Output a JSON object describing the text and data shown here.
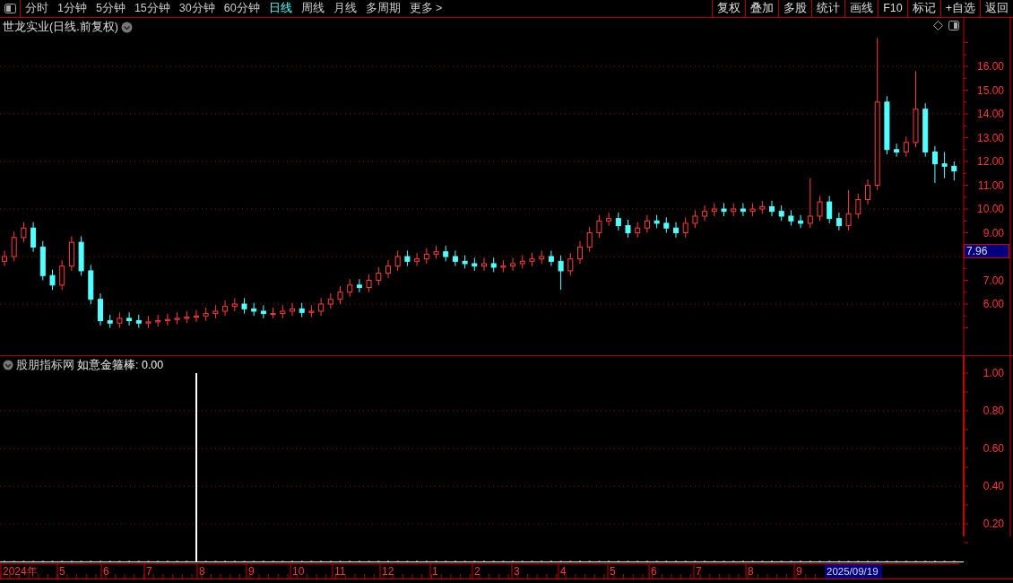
{
  "toolbar": {
    "periods": [
      {
        "label": "分时",
        "selected": false
      },
      {
        "label": "1分钟",
        "selected": false
      },
      {
        "label": "5分钟",
        "selected": false
      },
      {
        "label": "15分钟",
        "selected": false
      },
      {
        "label": "30分钟",
        "selected": false
      },
      {
        "label": "60分钟",
        "selected": false
      },
      {
        "label": "日线",
        "selected": true
      },
      {
        "label": "周线",
        "selected": false
      },
      {
        "label": "月线",
        "selected": false
      },
      {
        "label": "多周期",
        "selected": false
      },
      {
        "label": "更多 >",
        "selected": false
      }
    ],
    "buttons": [
      "复权",
      "叠加",
      "多股",
      "统计",
      "画线",
      "F10",
      "标记",
      "+自选",
      "返回"
    ]
  },
  "main_chart": {
    "title": "世龙实业(日线.前复权)",
    "cursor_price": "7.96",
    "chart_data": {
      "type": "candlestick",
      "ylim": [
        3.85,
        18.04
      ],
      "grid": true,
      "yticks": [
        {
          "value": 16,
          "label": "16.00"
        },
        {
          "value": 15,
          "label": "15.00"
        },
        {
          "value": 14,
          "label": "14.00"
        },
        {
          "value": 13,
          "label": "13.00"
        },
        {
          "value": 12,
          "label": "12.00"
        },
        {
          "value": 11,
          "label": "11.00"
        },
        {
          "value": 10,
          "label": "10.00"
        },
        {
          "value": 9,
          "label": "9.00"
        },
        {
          "value": 7,
          "label": "7.00"
        },
        {
          "value": 6,
          "label": "6.00"
        }
      ],
      "ohlc": [
        [
          7.8,
          8.25,
          7.6,
          8.0
        ],
        [
          8.0,
          9.05,
          7.8,
          8.8
        ],
        [
          8.8,
          9.45,
          8.6,
          9.2
        ],
        [
          9.2,
          9.45,
          8.2,
          8.4
        ],
        [
          8.4,
          8.65,
          7.0,
          7.2
        ],
        [
          7.2,
          7.45,
          6.6,
          6.8
        ],
        [
          6.8,
          7.85,
          6.6,
          7.6
        ],
        [
          7.6,
          8.85,
          7.4,
          8.6
        ],
        [
          8.6,
          8.85,
          7.2,
          7.4
        ],
        [
          7.4,
          7.65,
          6.0,
          6.2
        ],
        [
          6.2,
          6.45,
          5.1,
          5.3
        ],
        [
          5.3,
          5.55,
          5.0,
          5.2
        ],
        [
          5.2,
          5.65,
          5.0,
          5.4
        ],
        [
          5.4,
          5.65,
          5.1,
          5.3
        ],
        [
          5.3,
          5.55,
          5.0,
          5.2
        ],
        [
          5.2,
          5.5,
          5.0,
          5.25
        ],
        [
          5.25,
          5.55,
          5.05,
          5.3
        ],
        [
          5.3,
          5.6,
          5.1,
          5.35
        ],
        [
          5.35,
          5.65,
          5.15,
          5.4
        ],
        [
          5.4,
          5.7,
          5.2,
          5.45
        ],
        [
          5.45,
          5.75,
          5.25,
          5.5
        ],
        [
          5.5,
          5.85,
          5.3,
          5.6
        ],
        [
          5.6,
          5.95,
          5.4,
          5.7
        ],
        [
          5.7,
          6.15,
          5.5,
          5.9
        ],
        [
          5.9,
          6.25,
          5.7,
          6.0
        ],
        [
          6.0,
          6.25,
          5.6,
          5.8
        ],
        [
          5.8,
          6.05,
          5.5,
          5.7
        ],
        [
          5.7,
          5.95,
          5.4,
          5.6
        ],
        [
          5.6,
          5.85,
          5.4,
          5.6
        ],
        [
          5.6,
          5.95,
          5.4,
          5.7
        ],
        [
          5.7,
          6.05,
          5.5,
          5.8
        ],
        [
          5.8,
          6.05,
          5.45,
          5.65
        ],
        [
          5.65,
          5.95,
          5.45,
          5.7
        ],
        [
          5.7,
          6.25,
          5.5,
          6.0
        ],
        [
          6.0,
          6.45,
          5.8,
          6.2
        ],
        [
          6.2,
          6.75,
          6.0,
          6.5
        ],
        [
          6.5,
          7.05,
          6.3,
          6.8
        ],
        [
          6.8,
          7.05,
          6.5,
          6.7
        ],
        [
          6.7,
          7.25,
          6.5,
          7.0
        ],
        [
          7.0,
          7.55,
          6.8,
          7.3
        ],
        [
          7.3,
          7.85,
          7.1,
          7.6
        ],
        [
          7.6,
          8.25,
          7.4,
          8.0
        ],
        [
          8.0,
          8.25,
          7.6,
          7.8
        ],
        [
          7.8,
          8.15,
          7.6,
          7.9
        ],
        [
          7.9,
          8.35,
          7.7,
          8.1
        ],
        [
          8.1,
          8.45,
          7.9,
          8.2
        ],
        [
          8.2,
          8.45,
          7.8,
          8.0
        ],
        [
          8.0,
          8.25,
          7.6,
          7.8
        ],
        [
          7.8,
          8.05,
          7.5,
          7.7
        ],
        [
          7.7,
          7.95,
          7.4,
          7.6
        ],
        [
          7.6,
          7.95,
          7.4,
          7.7
        ],
        [
          7.7,
          7.95,
          7.35,
          7.55
        ],
        [
          7.55,
          7.85,
          7.35,
          7.6
        ],
        [
          7.6,
          7.95,
          7.4,
          7.7
        ],
        [
          7.7,
          8.05,
          7.5,
          7.8
        ],
        [
          7.8,
          8.15,
          7.6,
          7.9
        ],
        [
          7.9,
          8.25,
          7.7,
          8.0
        ],
        [
          8.0,
          8.25,
          7.6,
          7.8
        ],
        [
          7.8,
          8.05,
          6.6,
          7.4
        ],
        [
          7.4,
          8.15,
          7.2,
          7.9
        ],
        [
          7.9,
          8.65,
          7.7,
          8.4
        ],
        [
          8.4,
          9.25,
          8.2,
          9.0
        ],
        [
          9.0,
          9.75,
          8.8,
          9.5
        ],
        [
          9.5,
          9.85,
          9.3,
          9.6
        ],
        [
          9.6,
          9.85,
          9.1,
          9.3
        ],
        [
          9.3,
          9.55,
          8.8,
          9.0
        ],
        [
          9.0,
          9.45,
          8.8,
          9.2
        ],
        [
          9.2,
          9.75,
          9.0,
          9.5
        ],
        [
          9.5,
          9.75,
          9.2,
          9.4
        ],
        [
          9.4,
          9.65,
          9.0,
          9.2
        ],
        [
          9.2,
          9.45,
          8.8,
          9.0
        ],
        [
          9.0,
          9.65,
          8.8,
          9.4
        ],
        [
          9.4,
          9.95,
          9.2,
          9.7
        ],
        [
          9.7,
          10.15,
          9.5,
          9.9
        ],
        [
          9.9,
          10.25,
          9.7,
          10.0
        ],
        [
          10.0,
          10.25,
          9.7,
          9.9
        ],
        [
          9.9,
          10.25,
          9.7,
          10.0
        ],
        [
          10.0,
          10.25,
          9.7,
          9.9
        ],
        [
          9.9,
          10.25,
          9.7,
          10.0
        ],
        [
          10.0,
          10.35,
          9.8,
          10.1
        ],
        [
          10.1,
          10.35,
          9.7,
          9.9
        ],
        [
          9.9,
          10.15,
          9.5,
          9.7
        ],
        [
          9.7,
          9.95,
          9.3,
          9.5
        ],
        [
          9.5,
          9.75,
          9.2,
          9.4
        ],
        [
          9.4,
          11.3,
          9.2,
          9.7
        ],
        [
          9.7,
          10.55,
          9.5,
          10.3
        ],
        [
          10.3,
          10.55,
          9.4,
          9.6
        ],
        [
          9.6,
          9.85,
          9.1,
          9.3
        ],
        [
          9.3,
          10.8,
          9.1,
          9.8
        ],
        [
          9.8,
          10.65,
          9.6,
          10.4
        ],
        [
          10.4,
          11.25,
          10.2,
          11.0
        ],
        [
          11.0,
          17.2,
          10.8,
          14.5
        ],
        [
          14.5,
          14.75,
          12.3,
          12.5
        ],
        [
          12.5,
          12.75,
          12.2,
          12.4
        ],
        [
          12.4,
          13.05,
          12.2,
          12.8
        ],
        [
          12.8,
          15.8,
          12.6,
          14.2
        ],
        [
          14.2,
          14.45,
          12.2,
          12.4
        ],
        [
          12.4,
          12.65,
          11.1,
          11.9
        ],
        [
          11.9,
          12.4,
          11.3,
          11.8
        ],
        [
          11.8,
          12.0,
          11.2,
          11.6
        ]
      ]
    }
  },
  "indicator_panel": {
    "source": "股朋指标网",
    "reading": "如意金箍棒: 0.00",
    "chart_data": {
      "type": "bar",
      "ylim": [
        0,
        1.1
      ],
      "grid": true,
      "yticks": [
        {
          "value": 0.2,
          "label": "0.20"
        },
        {
          "value": 0.4,
          "label": "0.40"
        },
        {
          "value": 0.6,
          "label": "0.60"
        },
        {
          "value": 0.8,
          "label": "0.80"
        },
        {
          "value": 1,
          "label": "1.00"
        }
      ],
      "values": [
        0,
        0,
        0,
        0,
        0,
        0,
        0,
        0,
        0,
        0,
        0,
        0,
        0,
        0,
        0,
        0,
        0,
        0,
        0,
        0,
        1,
        0,
        0,
        0,
        0,
        0,
        0,
        0,
        0,
        0,
        0,
        0,
        0,
        0,
        0,
        0,
        0,
        0,
        0,
        0,
        0,
        0,
        0,
        0,
        0,
        0,
        0,
        0,
        0,
        0,
        0,
        0,
        0,
        0,
        0,
        0,
        0,
        0,
        0,
        0,
        0,
        0,
        0,
        0,
        0,
        0,
        0,
        0,
        0,
        0,
        0,
        0,
        0,
        0,
        0,
        0,
        0,
        0,
        0,
        0,
        0,
        0,
        0,
        0,
        0,
        0,
        0,
        0,
        0,
        0,
        0,
        0,
        0,
        0,
        0,
        0,
        0,
        0,
        0,
        0
      ]
    }
  },
  "date_axis": {
    "labels": [
      "2024年",
      "5",
      "6",
      "7",
      "8",
      "9",
      "10",
      "11",
      "12",
      "1",
      "2",
      "3",
      "4",
      "5",
      "6",
      "7",
      "8",
      "9"
    ],
    "cursor_date": "2025/09/19"
  }
}
